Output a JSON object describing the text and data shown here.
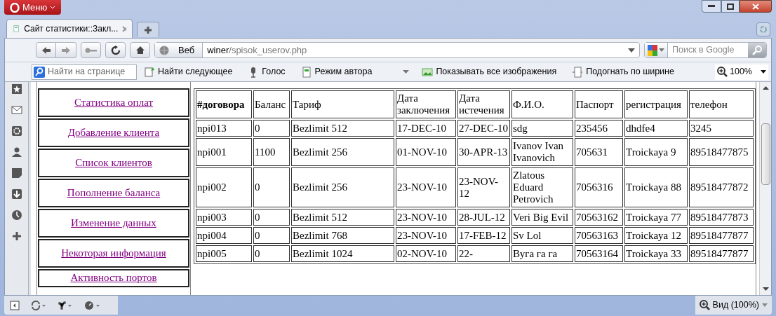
{
  "window": {
    "menu_button": "Меню"
  },
  "tabs": [
    {
      "title": "Сайт статистики::Закл...",
      "selected": true
    }
  ],
  "address_bar": {
    "scheme": "Веб",
    "host": "winer",
    "path": "/spisok_userov.php"
  },
  "search": {
    "placeholder": "Поиск в Google"
  },
  "toolbar": {
    "find_placeholder": "Найти на странице",
    "items": [
      {
        "kind": "find",
        "label": "Найти следующее"
      },
      {
        "kind": "voice",
        "label": "Голос"
      },
      {
        "kind": "author",
        "label": "Режим автора"
      },
      {
        "kind": "images",
        "label": "Показывать все изображения"
      },
      {
        "kind": "fit",
        "label": "Подогнать по ширине"
      }
    ],
    "zoom": "100%"
  },
  "nav_links": [
    "Статистика оплат",
    "Добавление клиента",
    "Список клиентов",
    "Пополнение баланса",
    "Изменение данных",
    "Некоторая информация",
    "Активность портов"
  ],
  "table": {
    "columns": [
      "#договора",
      "Баланс",
      "Тариф",
      "Дата заключения",
      "Дата истечения",
      "Ф.И.О.",
      "Паспорт",
      "регистрация",
      "телефон"
    ],
    "rows": [
      [
        "npi013",
        "0",
        "Bezlimit 512",
        "17-DEC-10",
        "27-DEC-10",
        "sdg",
        "235456",
        "dhdfe4",
        "3245"
      ],
      [
        "npi001",
        "1100",
        "Bezlimit 256",
        "01-NOV-10",
        "30-APR-13",
        "Ivanov Ivan Ivanovich",
        "705631",
        "Troickaya 9",
        "89518477875"
      ],
      [
        "npi002",
        "0",
        "Bezlimit 256",
        "23-NOV-10",
        "23-NOV-12",
        "Zlatous Eduard Petrovich",
        "7056316",
        "Troickaya 88",
        "89518477872"
      ],
      [
        "npi003",
        "0",
        "Bezlimit 512",
        "23-NOV-10",
        "28-JUL-12",
        "Veri Big Evil",
        "70563162",
        "Troickaya 77",
        "89518477873"
      ],
      [
        "npi004",
        "0",
        "Bezlimit 768",
        "23-NOV-10",
        "17-FEB-12",
        "Sv Lol",
        "70563163",
        "Troickaya 12",
        "89518477877"
      ],
      [
        "npi005",
        "0",
        "Bezlimit 1024",
        "02-NOV-10",
        "22-",
        "Вуга га га",
        "70563164",
        "Troickaya 33",
        "89518477877"
      ]
    ]
  },
  "status_bar": {
    "zoom": "Вид (100%)"
  }
}
